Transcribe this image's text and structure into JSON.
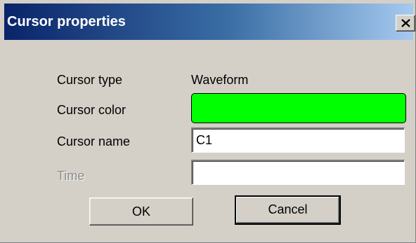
{
  "window": {
    "title": "Cursor properties",
    "close_glyph": "X"
  },
  "form": {
    "cursor_type": {
      "label": "Cursor type",
      "value": "Waveform"
    },
    "cursor_color": {
      "label": "Cursor color",
      "color": "#00ff00"
    },
    "cursor_name": {
      "label": "Cursor name",
      "value": "C1"
    },
    "time": {
      "label": "Time",
      "value": "",
      "enabled": false
    }
  },
  "buttons": {
    "ok_label": "OK",
    "cancel_label": "Cancel"
  },
  "colors": {
    "titlebar_start": "#0a246a",
    "titlebar_end": "#a6caf0",
    "dialog_face": "#d4d0c8",
    "swatch": "#00ff00"
  }
}
